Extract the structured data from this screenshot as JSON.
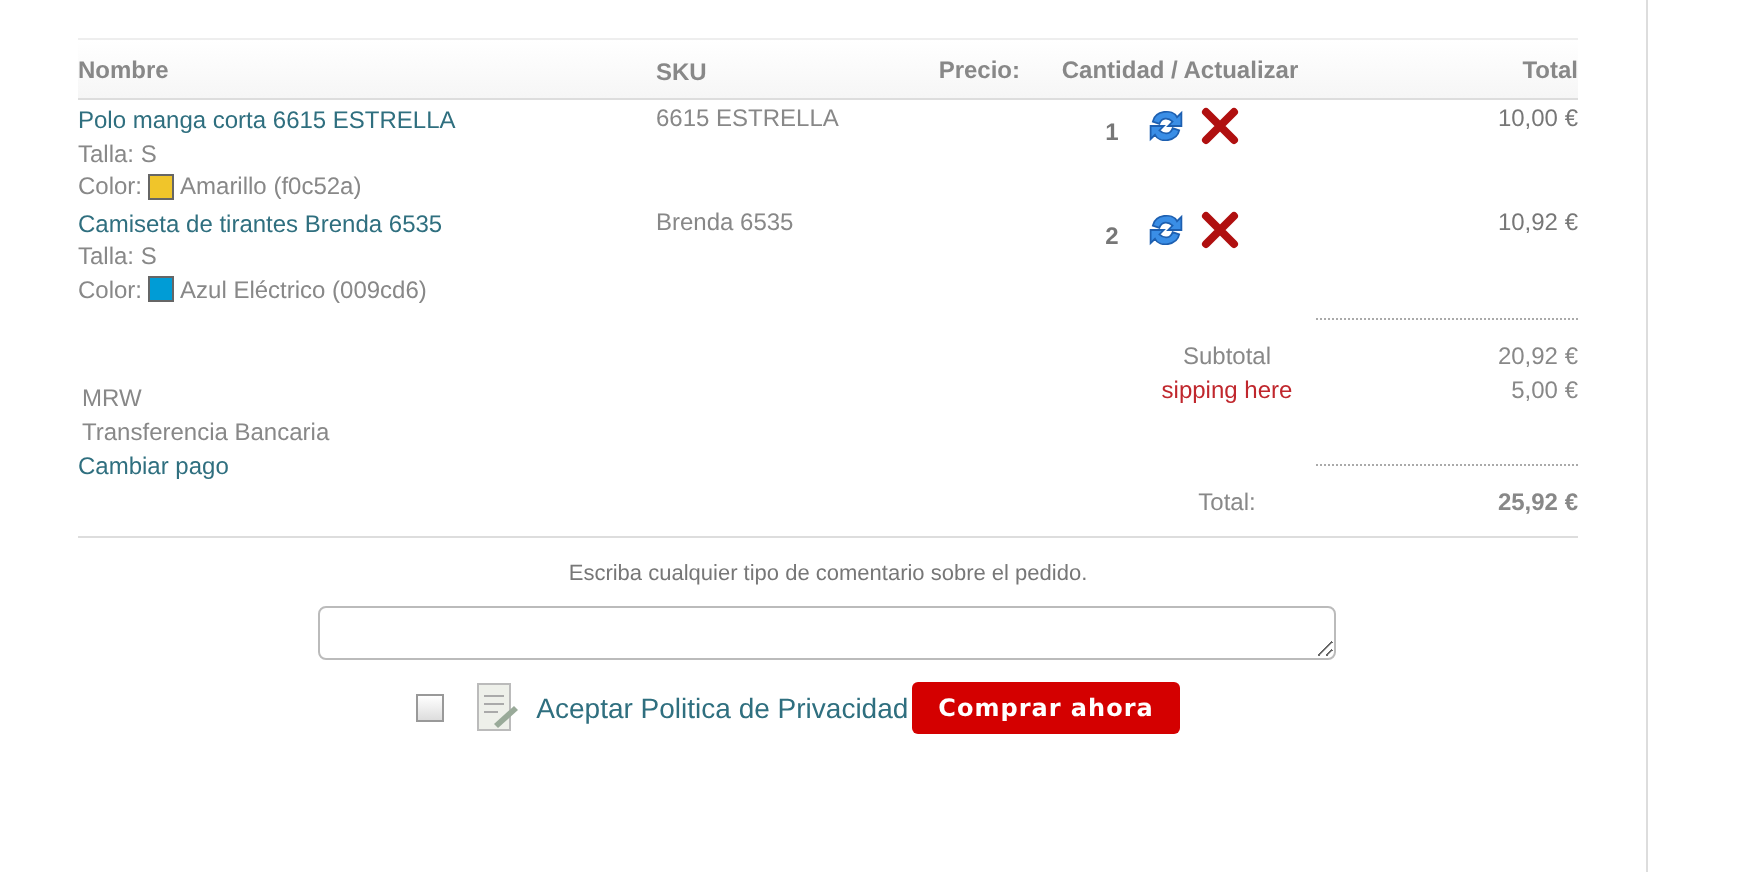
{
  "table": {
    "columns": [
      "Nombre",
      "SKU",
      "Precio:",
      "Cantidad / Actualizar",
      "Total"
    ],
    "rows": [
      {
        "name": "Polo manga corta 6615 ESTRELLA",
        "size": "Talla: S",
        "color_label": "Color:",
        "color_name": "Amarillo (f0c52a)",
        "color": "#f0c52a",
        "sku": "6615 ESTRELLA",
        "quantity": "1",
        "total": "10,00 €"
      },
      {
        "name": "Camiseta de tirantes Brenda 6535",
        "size": "Talla: S",
        "color_label": "Color:",
        "color_name": "Azul Eléctrico (009cd6)",
        "color": "#009cd6",
        "sku": "Brenda 6535",
        "quantity": "2",
        "total": "10,92 €"
      }
    ]
  },
  "shipping": {
    "carrier": "MRW",
    "payment": "Transferencia Bancaria",
    "change_link": "Cambiar pago"
  },
  "totals": [
    {
      "label": "Subtotal",
      "value": "20,92 €",
      "kind": "subtotal"
    },
    {
      "label": "sipping here",
      "value": "5,00 €",
      "kind": "shipping"
    },
    {
      "label": "Total:",
      "value": "25,92 €",
      "kind": "total"
    }
  ],
  "comment": {
    "label": "Escriba cualquier tipo de comentario sobre el pedido."
  },
  "privacy": {
    "checked": false,
    "label": "Aceptar Politica de Privacidad"
  },
  "buy_button": "Comprar ahora"
}
